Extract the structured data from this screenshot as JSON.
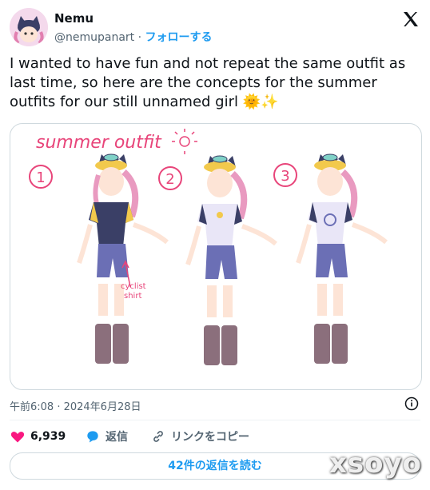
{
  "author": {
    "name": "Nemu",
    "handle": "@nemupanart",
    "separator": "·",
    "follow_label": "フォローする"
  },
  "tweet": {
    "text": "I wanted to have fun and not repeat the same outfit as last time, so here are the concepts for the summer outfits for our still unnamed girl 🌞✨"
  },
  "media": {
    "title": "summer outfit",
    "outfit_numbers": [
      "1",
      "2",
      "3"
    ],
    "annotation_line1": "cyclist",
    "annotation_line2": "shirt"
  },
  "timestamp": "午前6:08 · 2024年6月28日",
  "actions": {
    "likes_count": "6,939",
    "reply_label": "返信",
    "copy_link_label": "リンクをコピー"
  },
  "read_replies_label": "42件の返信を読む",
  "watermark": "xsoyo",
  "colors": {
    "accent": "#1d9bf0",
    "like": "#f91880",
    "secondary_text": "#536471",
    "sketch_pink": "#e8457a"
  },
  "icons": {
    "brand": "x-logo-icon",
    "info": "info-icon",
    "like": "heart-icon",
    "reply": "reply-bubble-icon",
    "link": "link-icon"
  }
}
